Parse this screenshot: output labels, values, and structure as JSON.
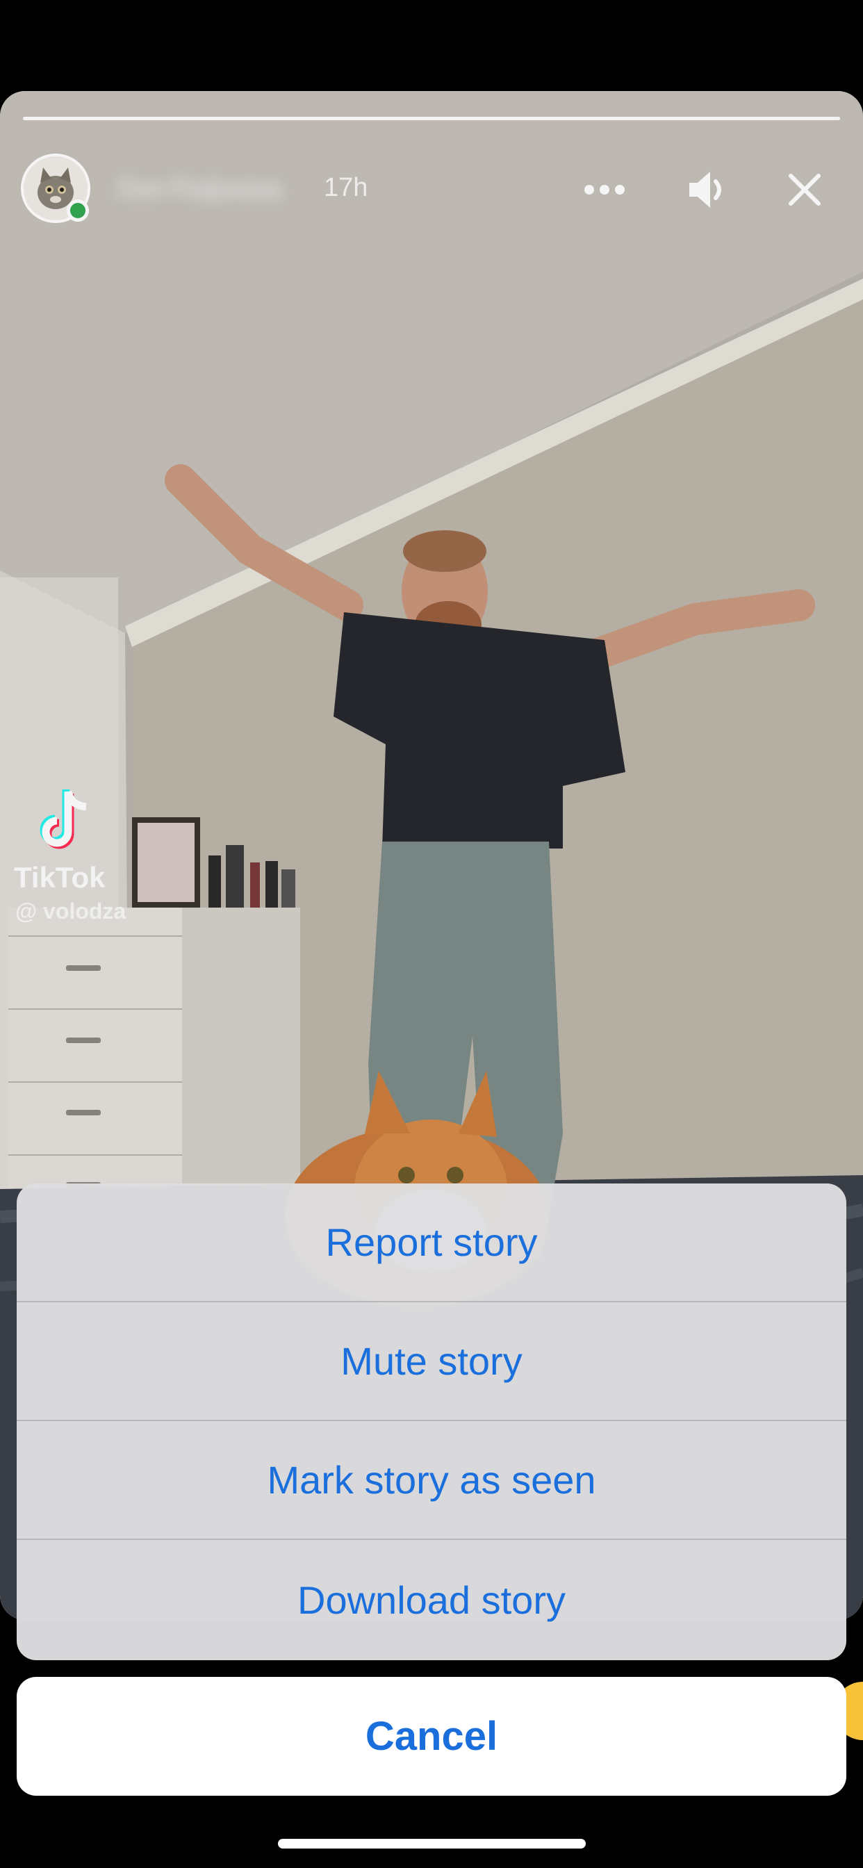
{
  "story": {
    "progress": 1.0,
    "timestamp": "17h",
    "username": "Лия Рафиева",
    "watermark": {
      "brand": "TikTok",
      "handle": "@ volodza"
    }
  },
  "icons": {
    "more": "ellipsis-icon",
    "sound": "speaker-icon",
    "close": "close-icon"
  },
  "action_sheet": {
    "items": [
      {
        "label": "Report story"
      },
      {
        "label": "Mute story"
      },
      {
        "label": "Mark story as seen"
      },
      {
        "label": "Download story"
      }
    ],
    "cancel": "Cancel"
  },
  "colors": {
    "action_text": "#1a6fdc",
    "online_status": "#33a852"
  }
}
